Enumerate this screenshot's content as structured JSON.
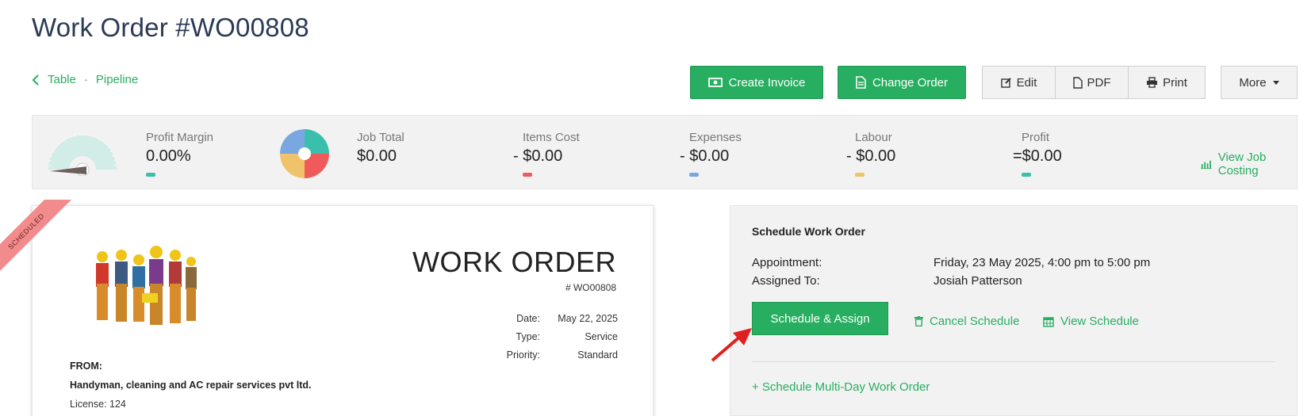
{
  "header": {
    "title": "Work Order #WO00808"
  },
  "breadcrumb": {
    "table": "Table",
    "separator": "·",
    "pipeline": "Pipeline"
  },
  "toolbar": {
    "create_invoice": "Create Invoice",
    "change_order": "Change Order",
    "edit": "Edit",
    "pdf": "PDF",
    "print": "Print",
    "more": "More"
  },
  "stats": {
    "profit_margin": {
      "label": "Profit Margin",
      "value": "0.00%"
    },
    "job_total": {
      "label": "Job Total",
      "value": "$0.00"
    },
    "items_cost": {
      "label": "Items Cost",
      "value": "- $0.00"
    },
    "expenses": {
      "label": "Expenses",
      "value": "- $0.00"
    },
    "labour": {
      "label": "Labour",
      "value": "- $0.00"
    },
    "profit": {
      "label": "Profit",
      "value": "=$0.00"
    },
    "view_costing": "View Job Costing",
    "colors": {
      "teal": "#3bbfad",
      "red": "#f05a5a",
      "blue": "#7aa7e0",
      "yellow": "#f0c36b",
      "green": "#27ae60"
    }
  },
  "document": {
    "ribbon": "SCHEDULED",
    "title": "WORK ORDER",
    "number": "# WO00808",
    "meta": [
      {
        "label": "Date:",
        "value": "May 22, 2025"
      },
      {
        "label": "Type:",
        "value": "Service"
      },
      {
        "label": "Priority:",
        "value": "Standard"
      }
    ],
    "from_label": "FROM:",
    "from_name": "Handyman, cleaning and AC repair services pvt ltd.",
    "license": "License: 124"
  },
  "schedule": {
    "title": "Schedule Work Order",
    "appointment_label": "Appointment:",
    "appointment_value": "Friday, 23 May 2025, 4:00 pm to 5:00 pm",
    "assigned_label": "Assigned To:",
    "assigned_value": "Josiah Patterson",
    "schedule_assign": "Schedule & Assign",
    "cancel_schedule": "Cancel Schedule",
    "view_schedule": "View Schedule",
    "multi_day": "+ Schedule Multi-Day Work Order"
  }
}
